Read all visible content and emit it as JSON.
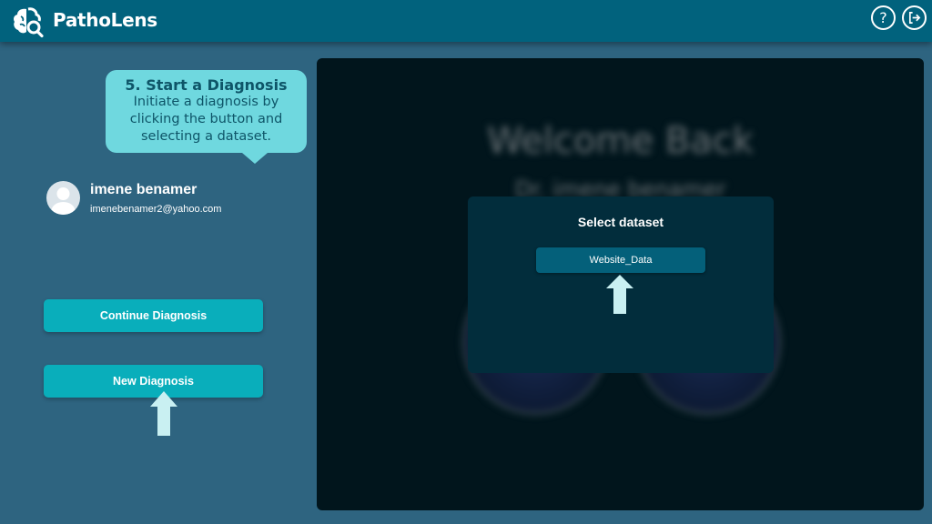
{
  "app": {
    "title": "PathoLens"
  },
  "header": {
    "help_glyph": "?",
    "help_icon": "question-circle-icon",
    "logout_icon": "logout-icon"
  },
  "tooltip": {
    "title": "5. Start a Diagnosis",
    "body": "Initiate a diagnosis by clicking the button and selecting a dataset."
  },
  "user": {
    "name": "imene benamer",
    "email": "imenebenamer2@yahoo.com"
  },
  "actions": {
    "continue_label": "Continue Diagnosis",
    "new_label": "New Diagnosis"
  },
  "main": {
    "welcome": "Welcome Back",
    "doctor": "Dr. imene benamer"
  },
  "modal": {
    "title": "Select dataset",
    "datasets": [
      "Website_Data"
    ]
  },
  "colors": {
    "header": "#01627d",
    "background": "#2e6480",
    "accent": "#09aebb",
    "tooltip": "#6fd8df",
    "panel": "#01151c",
    "modal": "#022d3c"
  }
}
